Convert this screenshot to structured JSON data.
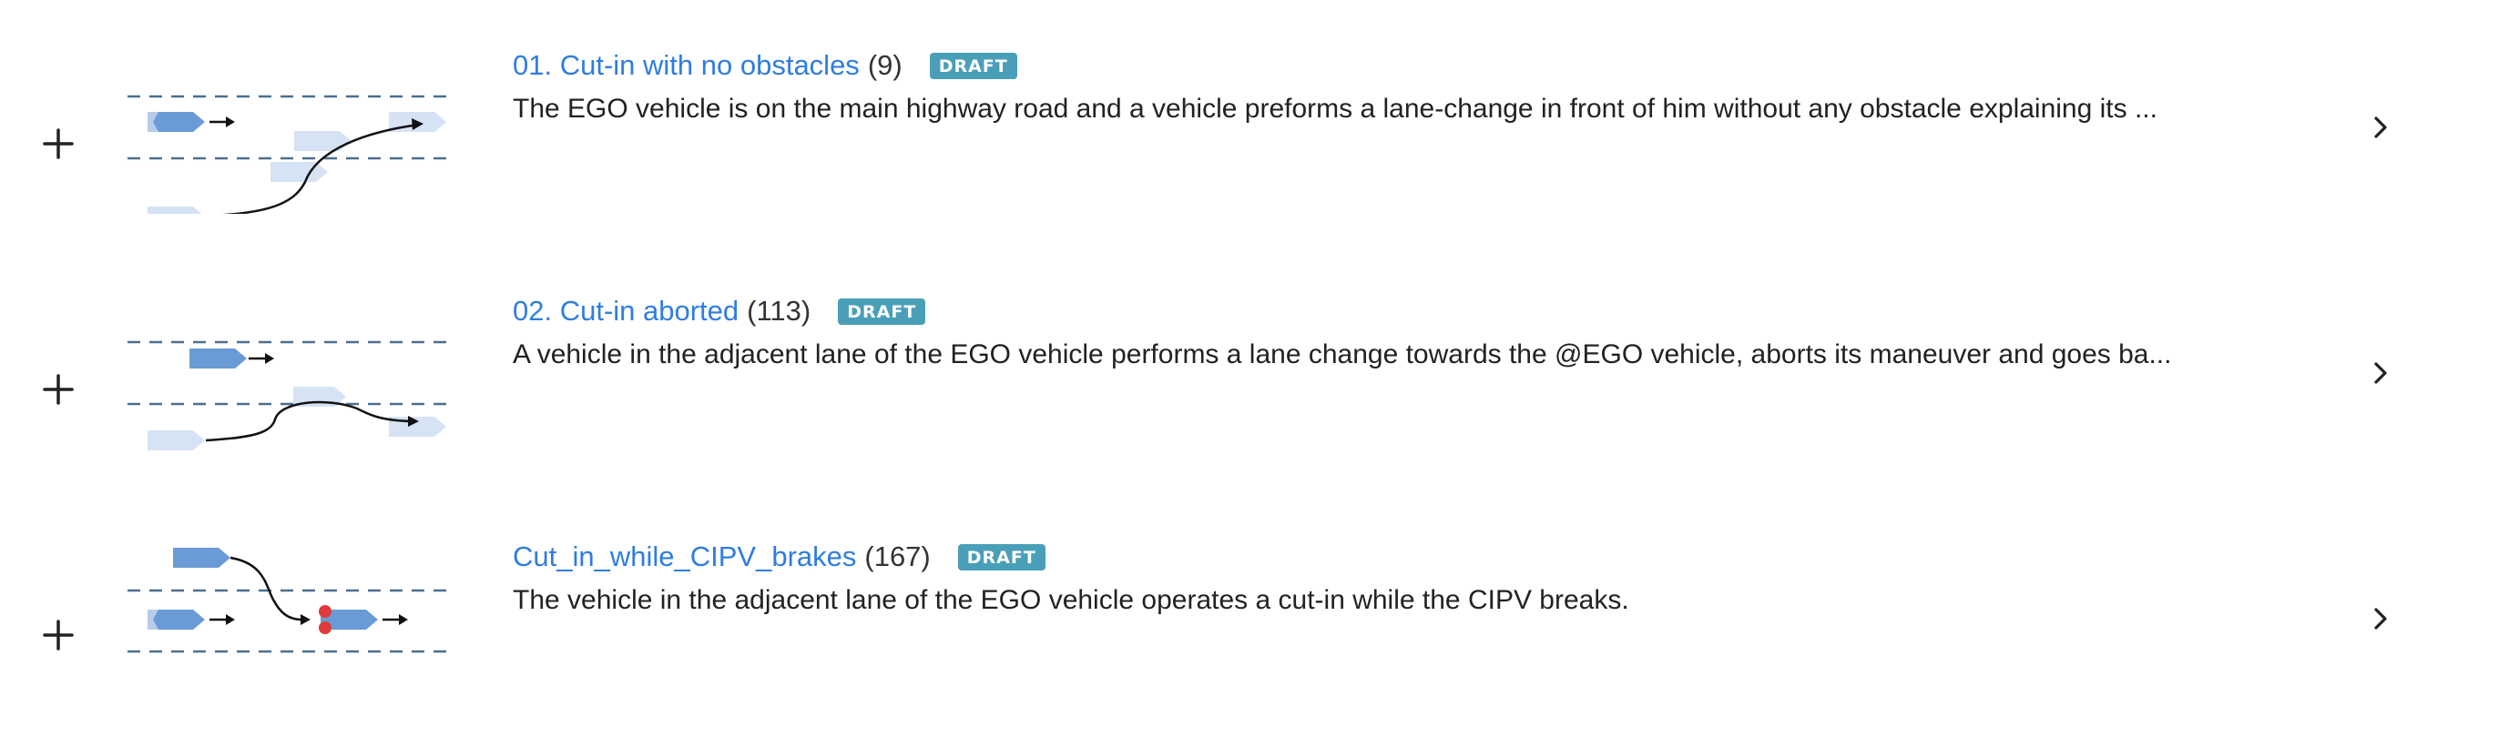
{
  "scenarios": [
    {
      "title": "01. Cut-in with no obstacles",
      "count": "(9)",
      "badge": "DRAFT",
      "description": "The EGO vehicle is on the main highway road and a vehicle preforms a lane-change in front of him without any obstacle explaining its ..."
    },
    {
      "title": "02. Cut-in aborted",
      "count": "(113)",
      "badge": "DRAFT",
      "description": "A vehicle in the adjacent lane of the EGO vehicle performs a lane change towards the @EGO vehicle, aborts its maneuver and goes ba..."
    },
    {
      "title": "Cut_in_while_CIPV_brakes",
      "count": "(167)",
      "badge": "DRAFT",
      "description": "The vehicle in the adjacent lane of the EGO vehicle operates a cut-in while the CIPV breaks."
    }
  ],
  "icons": {
    "add": "plus-icon",
    "open": "chevron-right-icon"
  },
  "colors": {
    "link": "#2f7de1",
    "badge": "#4a9fb8",
    "vehicle": "#6b9bd6",
    "ghost_vehicle": "#d5e3f4",
    "lane_line": "#4a6f90",
    "brake_light": "#e03b3b"
  }
}
